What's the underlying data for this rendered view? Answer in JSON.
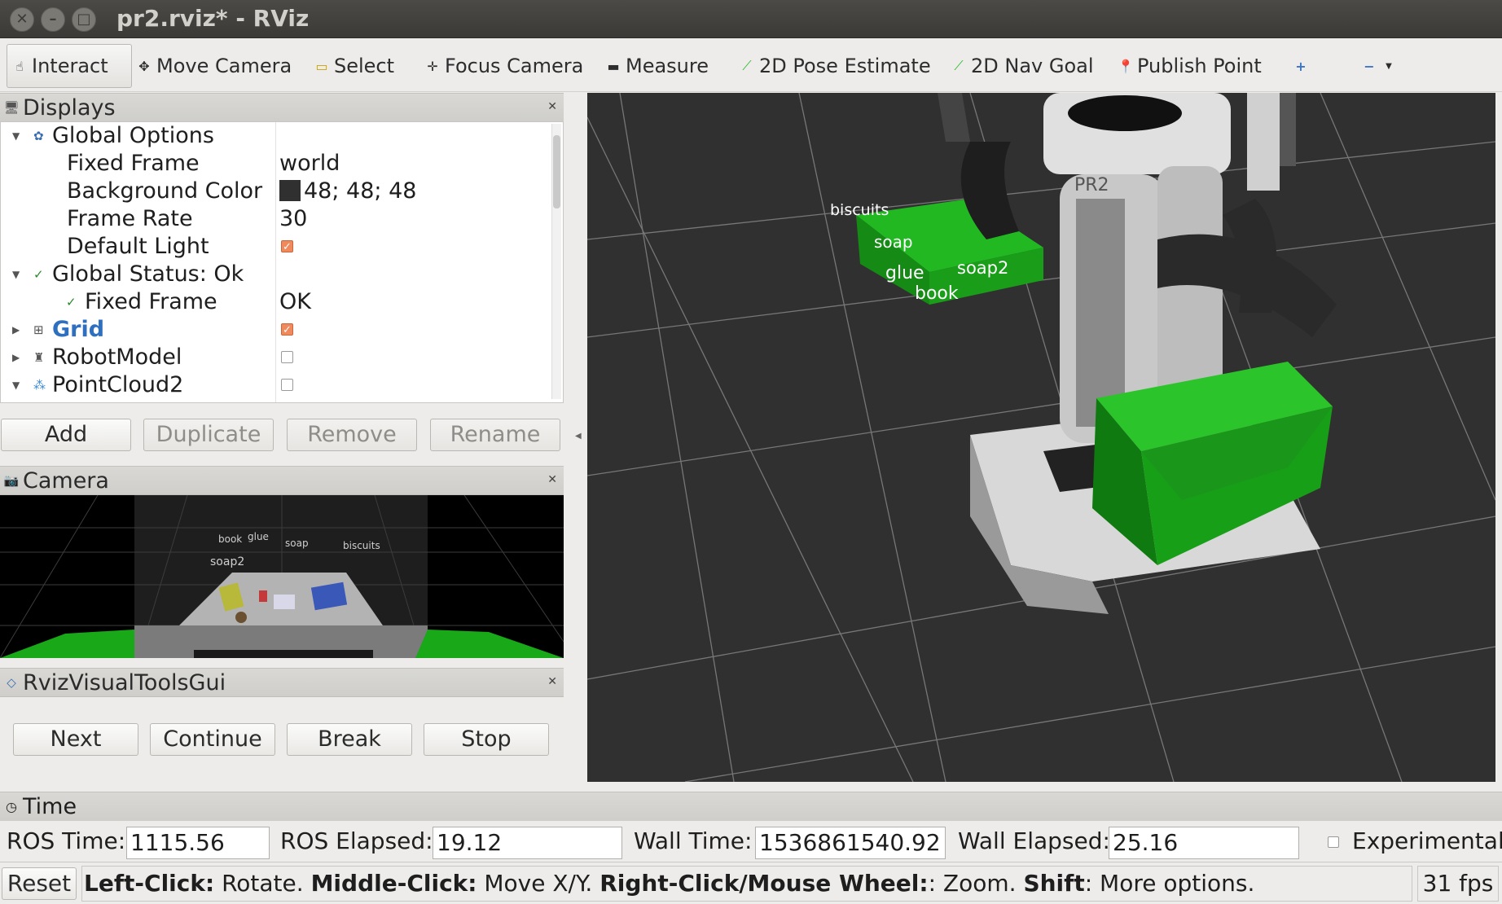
{
  "window": {
    "title": "pr2.rviz* - RViz",
    "buttons": [
      "close",
      "minimize",
      "maximize"
    ]
  },
  "toolbar": {
    "tools": [
      {
        "label": "Interact",
        "icon": "hand-pointer-icon",
        "active": true
      },
      {
        "label": "Move Camera",
        "icon": "move-camera-icon"
      },
      {
        "label": "Select",
        "icon": "select-box-icon"
      },
      {
        "label": "Focus Camera",
        "icon": "focus-target-icon"
      },
      {
        "label": "Measure",
        "icon": "ruler-icon"
      },
      {
        "label": "2D Pose Estimate",
        "icon": "green-arrow-icon"
      },
      {
        "label": "2D Nav Goal",
        "icon": "green-arrow-icon"
      },
      {
        "label": "Publish Point",
        "icon": "red-pin-icon"
      }
    ]
  },
  "displays": {
    "title": "Displays",
    "rows": [
      {
        "label": "Global Options",
        "icon": "gear-icon"
      },
      {
        "label": "Fixed Frame",
        "value": "world"
      },
      {
        "label": "Background Color",
        "value": "48; 48; 48",
        "swatch": "#303030"
      },
      {
        "label": "Frame Rate",
        "value": "30"
      },
      {
        "label": "Default Light",
        "checked": true
      },
      {
        "label": "Global Status: Ok",
        "icon": "check-icon"
      },
      {
        "label": "Fixed Frame",
        "value": "OK",
        "icon": "check-icon"
      },
      {
        "label": "Grid",
        "checked": true,
        "highlight": "#2f6fbf"
      },
      {
        "label": "RobotModel",
        "checked": false
      },
      {
        "label": "PointCloud2",
        "checked": false
      }
    ],
    "buttons": {
      "add": "Add",
      "duplicate": "Duplicate",
      "remove": "Remove",
      "rename": "Rename"
    }
  },
  "camera": {
    "title": "Camera",
    "labels": [
      "book",
      "glue",
      "soap",
      "biscuits",
      "soap2"
    ]
  },
  "rviz_tools": {
    "title": "RvizVisualToolsGui",
    "buttons": {
      "next": "Next",
      "continue": "Continue",
      "break": "Break",
      "stop": "Stop"
    }
  },
  "viewport": {
    "background": "#303030",
    "object_labels": [
      "biscuits",
      "soap",
      "glue",
      "soap2",
      "book"
    ],
    "robot_label": "PR2",
    "bin_color": "#1fa31f"
  },
  "time": {
    "title": "Time",
    "ros_time_label": "ROS Time:",
    "ros_time": "1115.56",
    "ros_elapsed_label": "ROS Elapsed:",
    "ros_elapsed": "19.12",
    "wall_time_label": "Wall Time:",
    "wall_time": "1536861540.92",
    "wall_elapsed_label": "Wall Elapsed:",
    "wall_elapsed": "25.16",
    "experimental_label": "Experimental",
    "experimental_checked": false
  },
  "statusbar": {
    "reset": "Reset",
    "hint_parts": [
      {
        "bold": "Left-Click:",
        "text": " Rotate. "
      },
      {
        "bold": "Middle-Click:",
        "text": " Move X/Y. "
      },
      {
        "bold": "Right-Click/Mouse Wheel:",
        "text": ": Zoom. "
      },
      {
        "bold": "Shift",
        "text": ": More options."
      }
    ],
    "fps": "31 fps"
  }
}
